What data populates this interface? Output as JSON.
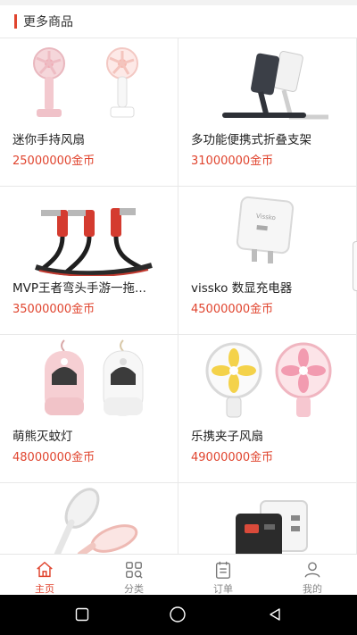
{
  "section": {
    "title": "更多商品"
  },
  "products": [
    {
      "name": "迷你手持风扇",
      "price": "25000000金币"
    },
    {
      "name": "多功能便携式折叠支架",
      "price": "31000000金币"
    },
    {
      "name": "MVP王者弯头手游一拖...",
      "price": "35000000金币"
    },
    {
      "name": "vissko 数显充电器",
      "price": "45000000金币"
    },
    {
      "name": "萌熊灭蚊灯",
      "price": "48000000金币"
    },
    {
      "name": "乐携夹子风扇",
      "price": "49000000金币"
    },
    {
      "name": "",
      "price": ""
    },
    {
      "name": "",
      "price": ""
    }
  ],
  "product_image_text": {
    "charger_brand": "Vissko"
  },
  "tabbar": {
    "tabs": [
      {
        "label": "主页",
        "icon": "home-icon",
        "active": true
      },
      {
        "label": "分类",
        "icon": "category-icon",
        "active": false
      },
      {
        "label": "订单",
        "icon": "order-icon",
        "active": false
      },
      {
        "label": "我的",
        "icon": "profile-icon",
        "active": false
      }
    ]
  },
  "system_nav": {
    "icons": [
      "recent-apps-icon",
      "home-circle-icon",
      "back-icon"
    ]
  },
  "colors": {
    "accent": "#e0442e",
    "divider": "#e8e8e8",
    "text": "#222222",
    "inactive": "#888888"
  }
}
